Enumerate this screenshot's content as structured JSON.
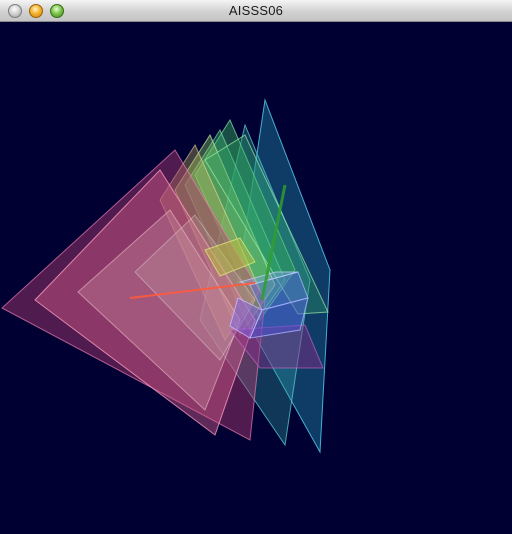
{
  "window": {
    "title": "AISSS06",
    "buttons": {
      "close": "close",
      "minimize": "minimize",
      "zoom": "zoom"
    }
  },
  "scene": {
    "background": "#000033",
    "panel_colors": {
      "cyan": "#3cb6cc",
      "teal": "#3aa6a6",
      "magenta": "#b8407a",
      "pink": "#d65a8a",
      "green": "#46b864",
      "lime": "#9ed870",
      "blue": "#6464e6",
      "yellow": "#d2c864"
    },
    "axis_colors": {
      "x": "#ff5a3c",
      "y": "#3cb43c"
    }
  }
}
